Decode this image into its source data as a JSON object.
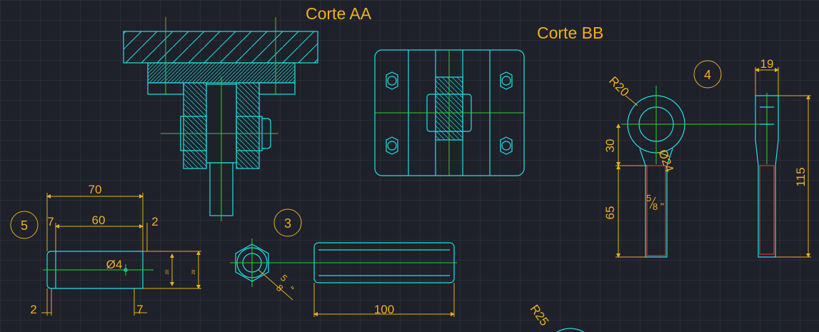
{
  "titles": {
    "section_aa": "Corte AA",
    "section_bb": "Corte BB"
  },
  "balloons": {
    "part_3": "3",
    "part_4": "4",
    "part_5": "5"
  },
  "dimensions": {
    "pin_total": "70",
    "pin_body": "60",
    "pin_left_chamfer": "7",
    "pin_right_gap": "2",
    "pin_hole_dia": "Ø4",
    "pin_bottom_left": "2",
    "pin_bottom_right": "7",
    "pin_small_a": "20",
    "pin_small_b": "28",
    "nut_thread_a": "5",
    "nut_thread_b": "8",
    "nut_thread_unit": "\"",
    "coupler_length": "100",
    "eye_radius": "R20",
    "eye_hole_dia": "Ø24",
    "eye_offset": "30",
    "eye_shank": "65",
    "eye_thread_a": "5",
    "eye_thread_b": "8",
    "eye_thread_unit": "\"",
    "side_width": "19",
    "side_height": "115",
    "bottom_radius": "R25"
  },
  "colors": {
    "background": "#1e2129",
    "grid": "#353a45",
    "outline": "#22e0e8",
    "centerline": "#2ed12e",
    "dimension": "#e8b020",
    "thread": "#e03030"
  }
}
